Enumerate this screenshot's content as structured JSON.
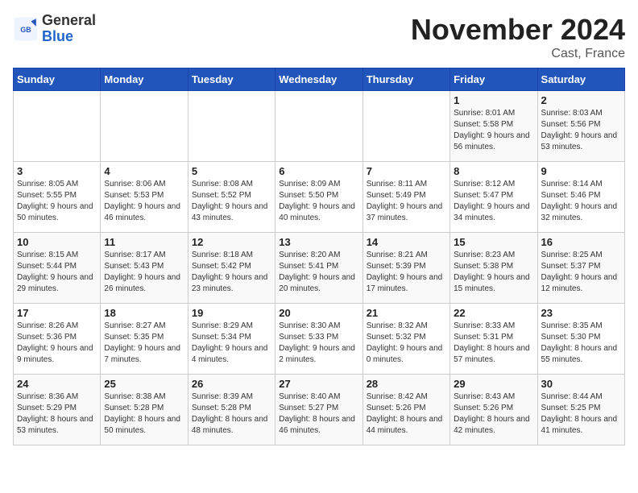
{
  "header": {
    "logo_general": "General",
    "logo_blue": "Blue",
    "month_title": "November 2024",
    "location": "Cast, France"
  },
  "weekdays": [
    "Sunday",
    "Monday",
    "Tuesday",
    "Wednesday",
    "Thursday",
    "Friday",
    "Saturday"
  ],
  "weeks": [
    [
      {
        "day": "",
        "info": ""
      },
      {
        "day": "",
        "info": ""
      },
      {
        "day": "",
        "info": ""
      },
      {
        "day": "",
        "info": ""
      },
      {
        "day": "",
        "info": ""
      },
      {
        "day": "1",
        "info": "Sunrise: 8:01 AM\nSunset: 5:58 PM\nDaylight: 9 hours and 56 minutes."
      },
      {
        "day": "2",
        "info": "Sunrise: 8:03 AM\nSunset: 5:56 PM\nDaylight: 9 hours and 53 minutes."
      }
    ],
    [
      {
        "day": "3",
        "info": "Sunrise: 8:05 AM\nSunset: 5:55 PM\nDaylight: 9 hours and 50 minutes."
      },
      {
        "day": "4",
        "info": "Sunrise: 8:06 AM\nSunset: 5:53 PM\nDaylight: 9 hours and 46 minutes."
      },
      {
        "day": "5",
        "info": "Sunrise: 8:08 AM\nSunset: 5:52 PM\nDaylight: 9 hours and 43 minutes."
      },
      {
        "day": "6",
        "info": "Sunrise: 8:09 AM\nSunset: 5:50 PM\nDaylight: 9 hours and 40 minutes."
      },
      {
        "day": "7",
        "info": "Sunrise: 8:11 AM\nSunset: 5:49 PM\nDaylight: 9 hours and 37 minutes."
      },
      {
        "day": "8",
        "info": "Sunrise: 8:12 AM\nSunset: 5:47 PM\nDaylight: 9 hours and 34 minutes."
      },
      {
        "day": "9",
        "info": "Sunrise: 8:14 AM\nSunset: 5:46 PM\nDaylight: 9 hours and 32 minutes."
      }
    ],
    [
      {
        "day": "10",
        "info": "Sunrise: 8:15 AM\nSunset: 5:44 PM\nDaylight: 9 hours and 29 minutes."
      },
      {
        "day": "11",
        "info": "Sunrise: 8:17 AM\nSunset: 5:43 PM\nDaylight: 9 hours and 26 minutes."
      },
      {
        "day": "12",
        "info": "Sunrise: 8:18 AM\nSunset: 5:42 PM\nDaylight: 9 hours and 23 minutes."
      },
      {
        "day": "13",
        "info": "Sunrise: 8:20 AM\nSunset: 5:41 PM\nDaylight: 9 hours and 20 minutes."
      },
      {
        "day": "14",
        "info": "Sunrise: 8:21 AM\nSunset: 5:39 PM\nDaylight: 9 hours and 17 minutes."
      },
      {
        "day": "15",
        "info": "Sunrise: 8:23 AM\nSunset: 5:38 PM\nDaylight: 9 hours and 15 minutes."
      },
      {
        "day": "16",
        "info": "Sunrise: 8:25 AM\nSunset: 5:37 PM\nDaylight: 9 hours and 12 minutes."
      }
    ],
    [
      {
        "day": "17",
        "info": "Sunrise: 8:26 AM\nSunset: 5:36 PM\nDaylight: 9 hours and 9 minutes."
      },
      {
        "day": "18",
        "info": "Sunrise: 8:27 AM\nSunset: 5:35 PM\nDaylight: 9 hours and 7 minutes."
      },
      {
        "day": "19",
        "info": "Sunrise: 8:29 AM\nSunset: 5:34 PM\nDaylight: 9 hours and 4 minutes."
      },
      {
        "day": "20",
        "info": "Sunrise: 8:30 AM\nSunset: 5:33 PM\nDaylight: 9 hours and 2 minutes."
      },
      {
        "day": "21",
        "info": "Sunrise: 8:32 AM\nSunset: 5:32 PM\nDaylight: 9 hours and 0 minutes."
      },
      {
        "day": "22",
        "info": "Sunrise: 8:33 AM\nSunset: 5:31 PM\nDaylight: 8 hours and 57 minutes."
      },
      {
        "day": "23",
        "info": "Sunrise: 8:35 AM\nSunset: 5:30 PM\nDaylight: 8 hours and 55 minutes."
      }
    ],
    [
      {
        "day": "24",
        "info": "Sunrise: 8:36 AM\nSunset: 5:29 PM\nDaylight: 8 hours and 53 minutes."
      },
      {
        "day": "25",
        "info": "Sunrise: 8:38 AM\nSunset: 5:28 PM\nDaylight: 8 hours and 50 minutes."
      },
      {
        "day": "26",
        "info": "Sunrise: 8:39 AM\nSunset: 5:28 PM\nDaylight: 8 hours and 48 minutes."
      },
      {
        "day": "27",
        "info": "Sunrise: 8:40 AM\nSunset: 5:27 PM\nDaylight: 8 hours and 46 minutes."
      },
      {
        "day": "28",
        "info": "Sunrise: 8:42 AM\nSunset: 5:26 PM\nDaylight: 8 hours and 44 minutes."
      },
      {
        "day": "29",
        "info": "Sunrise: 8:43 AM\nSunset: 5:26 PM\nDaylight: 8 hours and 42 minutes."
      },
      {
        "day": "30",
        "info": "Sunrise: 8:44 AM\nSunset: 5:25 PM\nDaylight: 8 hours and 41 minutes."
      }
    ]
  ]
}
